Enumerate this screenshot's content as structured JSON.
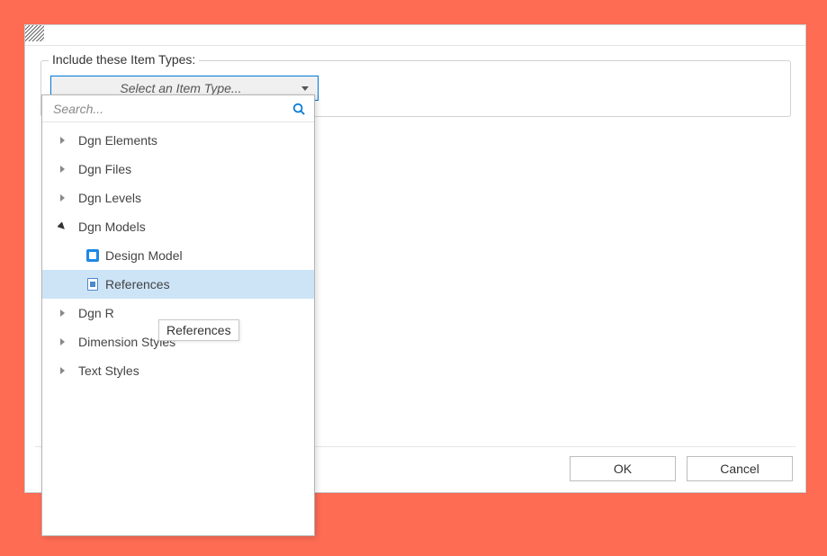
{
  "dialog": {
    "legend": "Include these Item Types:",
    "select_placeholder": "Select an Item Type..."
  },
  "search": {
    "placeholder": "Search..."
  },
  "tree": {
    "items": [
      {
        "label": "Dgn Elements",
        "expanded": false
      },
      {
        "label": "Dgn Files",
        "expanded": false
      },
      {
        "label": "Dgn Levels",
        "expanded": false
      },
      {
        "label": "Dgn Models",
        "expanded": true,
        "children": [
          {
            "label": "Design Model",
            "icon": "design-model-icon"
          },
          {
            "label": "References",
            "icon": "references-icon",
            "selected": true
          }
        ]
      },
      {
        "label": "Dgn R",
        "label_cut": "Dgn R",
        "expanded": false,
        "tooltip_overlay": true
      },
      {
        "label": "Dimension Styles",
        "expanded": false
      },
      {
        "label": "Text Styles",
        "expanded": false
      }
    ]
  },
  "tooltip": {
    "text": "References"
  },
  "buttons": {
    "ok": "OK",
    "cancel": "Cancel"
  }
}
